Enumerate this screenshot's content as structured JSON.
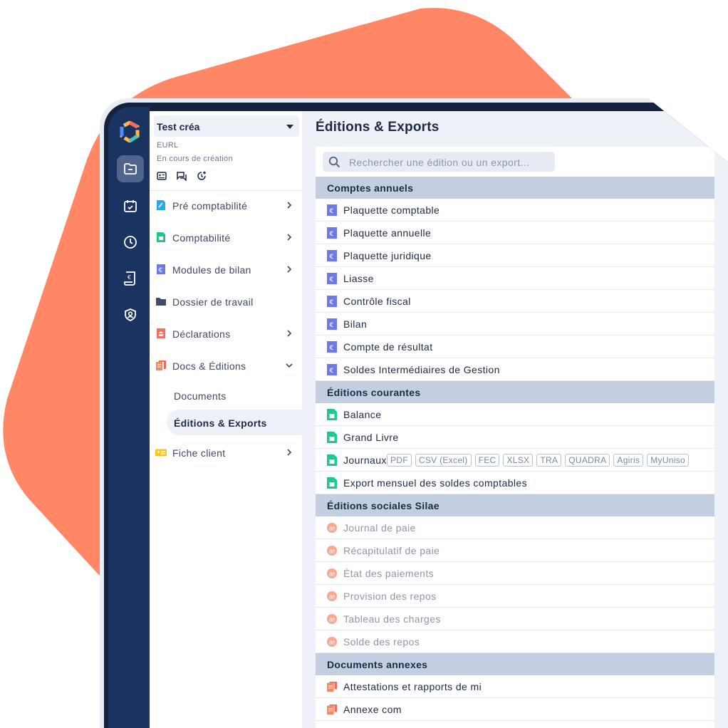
{
  "colors": {
    "accent": "#ff8765",
    "rail": "#1b3361",
    "section": "#c3cfe1"
  },
  "rail": {
    "icons": [
      "folder-icon",
      "calendar-check-icon",
      "clock-icon",
      "receipt-euro-icon",
      "user-shield-icon"
    ]
  },
  "sidebar": {
    "org_name": "Test créa",
    "org_type": "EURL",
    "org_status": "En cours de création",
    "items": [
      {
        "label": "Pré comptabilité",
        "icon": "pen-document-icon"
      },
      {
        "label": "Comptabilité",
        "icon": "calculator-document-icon"
      },
      {
        "label": "Modules de bilan",
        "icon": "euro-document-icon"
      },
      {
        "label": "Dossier de travail",
        "icon": "folder-icon"
      },
      {
        "label": "Déclarations",
        "icon": "bank-document-icon"
      },
      {
        "label": "Docs & Éditions",
        "icon": "docs-icon"
      },
      {
        "label": "Fiche client",
        "icon": "contact-card-icon"
      }
    ],
    "sub_items": [
      {
        "label": "Documents"
      },
      {
        "label": "Éditions & Exports"
      }
    ]
  },
  "main": {
    "title": "Éditions & Exports",
    "search_placeholder": "Rechercher une édition ou un export...",
    "sections": [
      {
        "title": "Comptes annuels",
        "icon": "euro-document-icon",
        "items": [
          "Plaquette comptable",
          "Plaquette annuelle",
          "Plaquette juridique",
          "Liasse",
          "Contrôle fiscal",
          "Bilan",
          "Compte de résultat",
          "Soldes Intermédiaires de Gestion"
        ]
      },
      {
        "title": "Éditions courantes",
        "icon": "green-document-icon",
        "items": [
          "Balance",
          "Grand Livre",
          "Journaux",
          "Export mensuel des soldes comptables"
        ]
      },
      {
        "title": "Éditions sociales Silae",
        "icon": "silae-icon",
        "items": [
          "Journal de paie",
          "Récapitulatif de paie",
          "État des paiements",
          "Provision des repos",
          "Tableau des charges",
          "Solde des repos"
        ]
      },
      {
        "title": "Documents annexes",
        "icon": "annex-document-icon",
        "items": [
          "Attestations et rapports de mi",
          "Annexe com"
        ]
      }
    ],
    "journaux_formats": [
      "PDF",
      "CSV (Excel)",
      "FEC",
      "XLSX",
      "TRA",
      "QUADRA",
      "Agiris",
      "MyUniso"
    ]
  }
}
